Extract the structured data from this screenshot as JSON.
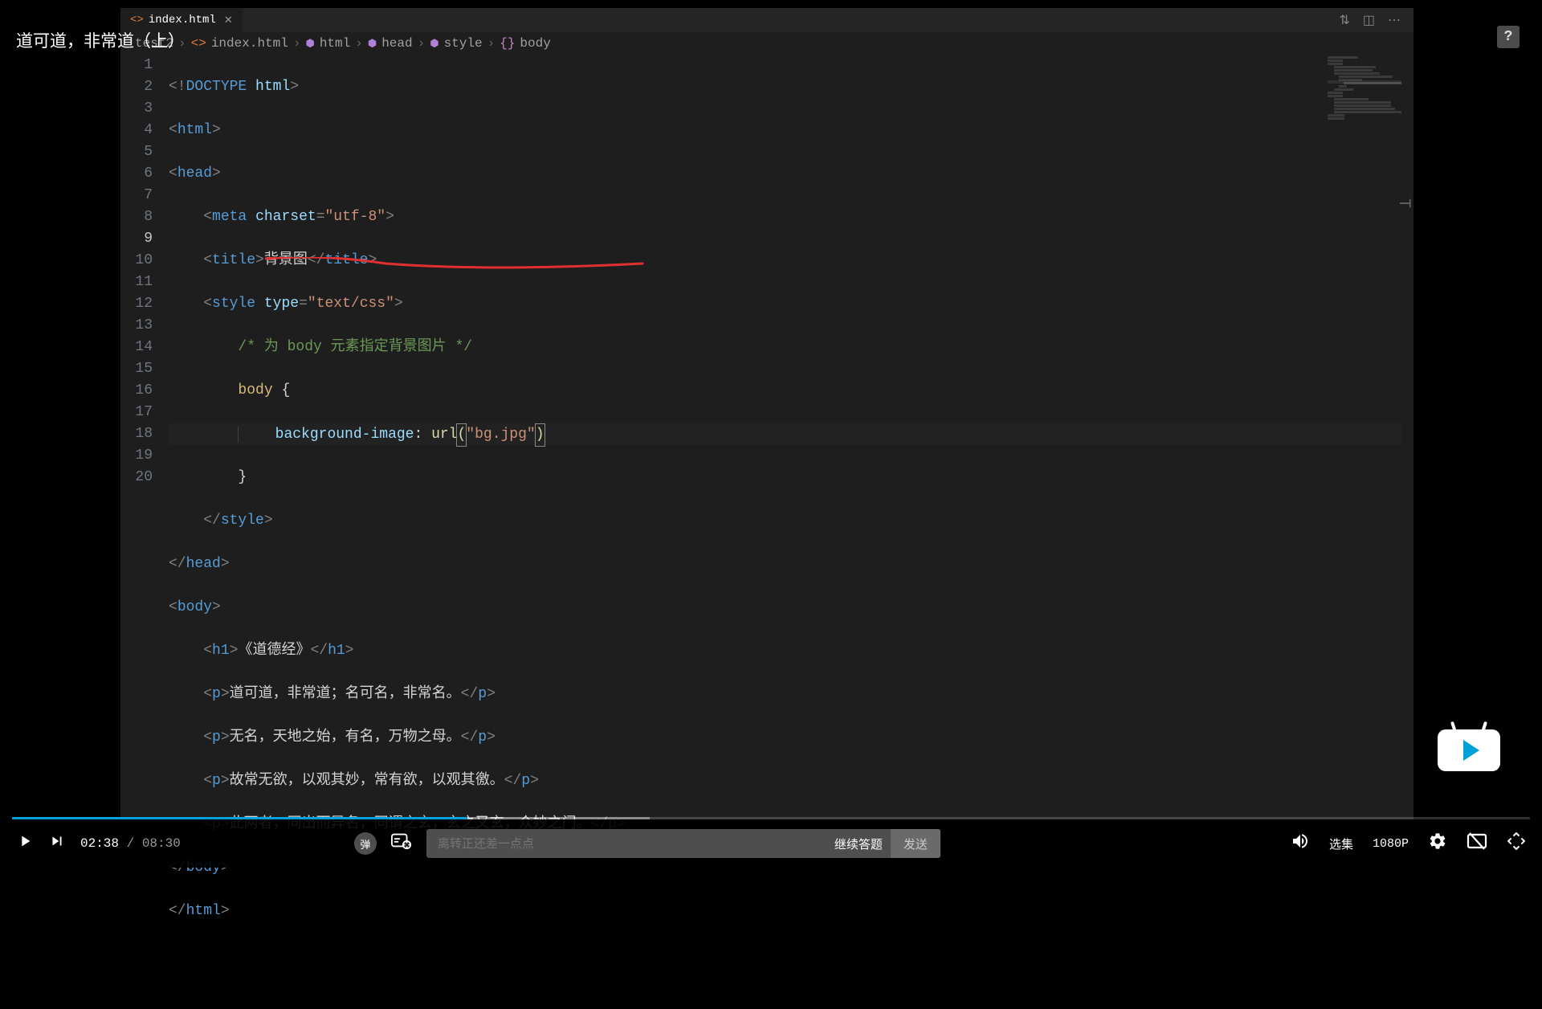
{
  "video": {
    "title": "道可道，非常道（上）",
    "time_current": "02:38",
    "time_total": "08:30",
    "danmu_toggle": "弹",
    "danmu_placeholder": "离转正还差一点点",
    "danmu_hint": "继续答题",
    "send_label": "发送",
    "episode_label": "选集",
    "quality_label": "1080P"
  },
  "editor": {
    "tab_name": "index.html",
    "breadcrumb": [
      "test2",
      "index.html",
      "html",
      "head",
      "style",
      "body"
    ],
    "lines": [
      "1",
      "2",
      "3",
      "4",
      "5",
      "6",
      "7",
      "8",
      "9",
      "10",
      "11",
      "12",
      "13",
      "14",
      "15",
      "16",
      "17",
      "18",
      "19",
      "20"
    ],
    "code": {
      "l1_doctype": "<!DOCTYPE html>",
      "l4_charset_attr": "charset",
      "l4_charset_val": "\"utf-8\"",
      "l5_title_text": "背景图",
      "l6_type_attr": "type",
      "l6_type_val": "\"text/css\"",
      "l7_comment": "/* 为 body 元素指定背景图片 */",
      "l8_selector": "body",
      "l9_prop": "background-image",
      "l9_func": "url",
      "l9_arg": "\"bg.jpg\"",
      "l14_h1_text": "《道德经》",
      "l15_p": "道可道，非常道；名可名，非常名。",
      "l16_p": "无名，天地之始，有名，万物之母。",
      "l17_p": "故常无欲，以观其妙，常有欲，以观其徼。",
      "l18_p": "此两者，同出而异名，同谓之玄，玄之又玄，众妙之门。"
    }
  },
  "tags": {
    "html": "html",
    "head": "head",
    "meta": "meta",
    "title": "title",
    "style": "style",
    "body": "body",
    "h1": "h1",
    "p": "p"
  }
}
